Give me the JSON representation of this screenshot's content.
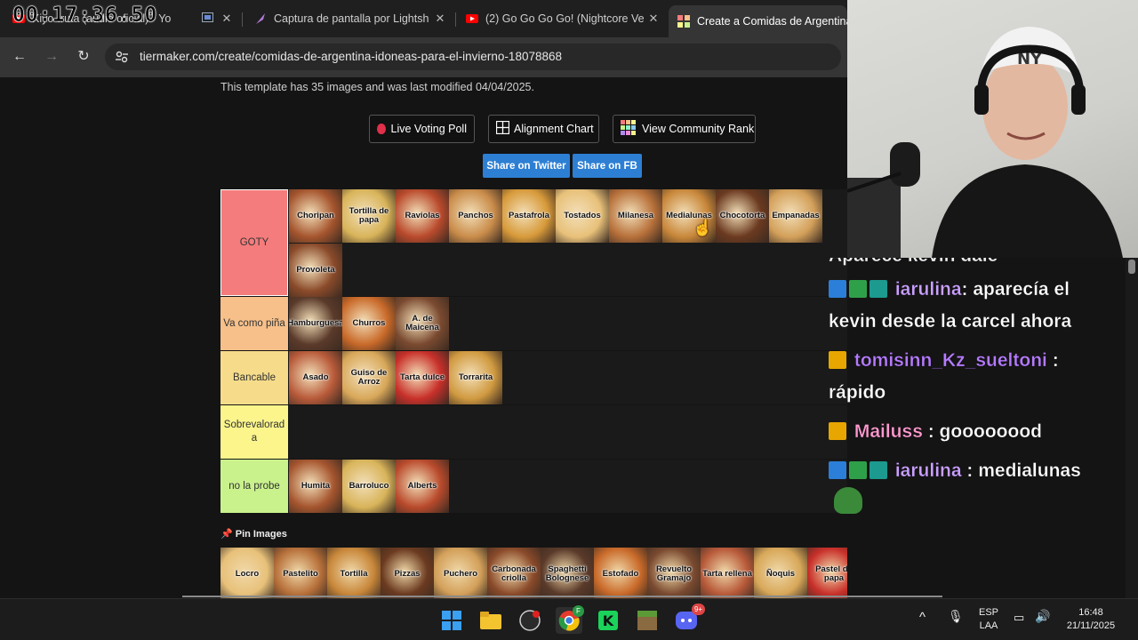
{
  "timer": "00:17:36.50",
  "tabs": [
    {
      "title": "Kiyo-fruta (audio oficial) - Yo",
      "icon": "youtube-icon"
    },
    {
      "title": "Captura de pantalla por Lightsh",
      "icon": "lightshot-feather-icon"
    },
    {
      "title": "(2) Go Go Go Go! (Nightcore Ve",
      "icon": "youtube-icon"
    },
    {
      "title": "Create a Comidas de Argentina",
      "icon": "tiermaker-icon"
    }
  ],
  "address": {
    "url": "tiermaker.com/create/comidas-de-argentina-idoneas-para-el-invierno-18078868"
  },
  "page": {
    "info": "This template has 35 images and was last modified 04/04/2025.",
    "buttons": {
      "live_voting": "Live Voting Poll",
      "alignment": "Alignment Chart",
      "community": "View Community Rank"
    },
    "share": {
      "twitter": "Share on Twitter",
      "fb": "Share on FB"
    },
    "pin_label": "Pin Images"
  },
  "tiers": [
    {
      "label": "GOTY",
      "color": "#f47c7c",
      "items": [
        "Choripan",
        "Tortilla de papa",
        "Raviolas",
        "Panchos",
        "Pastafrola",
        "Tostados",
        "Milanesa",
        "Medialunas",
        "Chocotorta",
        "Empanadas",
        "Provoleta"
      ]
    },
    {
      "label": "Va como piña",
      "color": "#f7c08a",
      "items": [
        "Hamburguesa",
        "Churros",
        "A. de Maicena"
      ]
    },
    {
      "label": "Bancable",
      "color": "#f6dc8a",
      "items": [
        "Asado",
        "Guiso de Arroz",
        "Tarta dulce",
        "Torrarita"
      ]
    },
    {
      "label": "Sobrevalorad a",
      "color": "#fbf58c",
      "items": []
    },
    {
      "label": "no la probe",
      "color": "#c9f28c",
      "items": [
        "Humita",
        "Barroluco",
        "Alberts"
      ]
    }
  ],
  "pins": [
    "Locro",
    "Pastelito",
    "Tortilla",
    "Pizzas",
    "Puchero",
    "Carbonada criolla",
    "Spaghetti Bolognese",
    "Estofado",
    "Revuelto Gramajo",
    "Tarta rellena",
    "Ñoquis",
    "Pastel de papa"
  ],
  "chat": [
    {
      "user": "",
      "msg": "Aparece kevin dale"
    },
    {
      "user": "iarulina",
      "msg": ": aparecía el",
      "cont": "kevin desde la carcel ahora",
      "color": "#c9a0ff"
    },
    {
      "user": "tomisinn_Kz_sueltoni",
      "msg": " :",
      "cont": "rápido",
      "color": "#b57bff"
    },
    {
      "user": "Mailuss",
      "msg": ": goooooood",
      "color": "#ff9ad0"
    },
    {
      "user": "iarulina",
      "msg": ": medialunas",
      "color": "#c9a0ff"
    }
  ],
  "taskbar": {
    "lang": "ESP",
    "lang2": "LAA",
    "time": "16:48",
    "date": "21/11/2025",
    "chrome_badge": "F",
    "discord_badge": "9+"
  }
}
